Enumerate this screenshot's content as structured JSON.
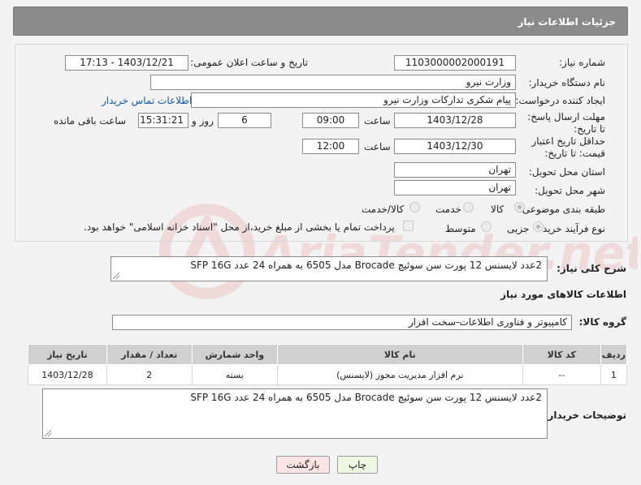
{
  "header": {
    "title": "جزئیات اطلاعات نیاز"
  },
  "form": {
    "need_number_label": "شماره نیاز:",
    "need_number": "1103000002000191",
    "announce_label": "تاریخ و ساعت اعلان عمومی:",
    "announce_value": "1403/12/21 - 17:13",
    "buyer_org_label": "نام دستگاه خریدار:",
    "buyer_org": "وزارت نیرو",
    "creator_label": "ایجاد کننده درخواست:",
    "creator": "پیام شکری تدارکات وزارت نیرو",
    "contact_link": "اطلاعات تماس خریدار",
    "reply_deadline_label": "مهلت ارسال پاسخ: تا تاریخ:",
    "reply_date": "1403/12/28",
    "time_label": "ساعت",
    "reply_time": "09:00",
    "days_value": "6",
    "days_and_label": "روز و",
    "remaining_time": "15:31:21",
    "remaining_label": "ساعت باقی مانده",
    "price_validity_label": "حداقل تاریخ اعتبار قیمت: تا تاریخ:",
    "price_date": "1403/12/30",
    "time_label2": "ساعت",
    "price_time": "12:00",
    "province_label": "استان محل تحویل:",
    "province": "تهران",
    "city_label": "شهر محل تحویل:",
    "city": "تهران",
    "category_label": "طبقه بندی موضوعی:",
    "category_options": [
      "کالا",
      "خدمت",
      "کالا/خدمت"
    ],
    "process_label": "نوع فرآیند خرید :",
    "process_options": [
      "جزیی",
      "متوسط"
    ],
    "payment_note": "پرداخت تمام یا بخشی از مبلغ خرید،از محل \"اسناد خزانه اسلامی\" خواهد بود."
  },
  "summary": {
    "label": "شرح کلی نیاز:",
    "text": "2عدد لایسنس 12 پورت سن سوئیچ Brocade مدل 6505 به همراه 24 عدد SFP 16G"
  },
  "goods": {
    "section_title": "اطلاعات کالاهای مورد نیاز",
    "group_label": "گروه کالا:",
    "group_value": "کامپیوتر و فناوری اطلاعات-سخت افزار",
    "columns": [
      "ردیف",
      "کد کالا",
      "نام کالا",
      "واحد شمارش",
      "تعداد / مقدار",
      "تاریخ نیاز"
    ],
    "rows": [
      [
        "1",
        "--",
        "نرم افزار مدیریت مجوز (لایسنس)",
        "بسته",
        "2",
        "1403/12/28"
      ]
    ]
  },
  "buyer_notes": {
    "label": "توضیحات خریدار:",
    "text": "2عدد لایسنس 12 پورت سن سوئیچ Brocade مدل 6505 به همراه 24 عدد SFP 16G"
  },
  "buttons": {
    "print": "چاپ",
    "back": "بازگشت"
  },
  "watermark": {
    "text": "AriaTender.net"
  }
}
